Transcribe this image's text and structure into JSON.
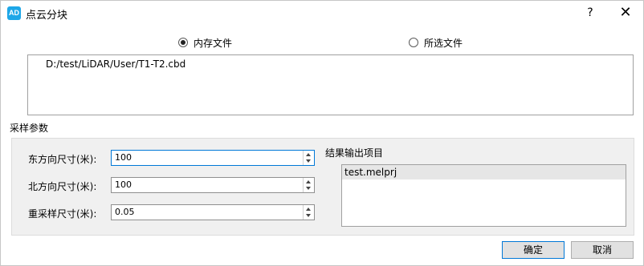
{
  "window": {
    "title": "点云分块",
    "icon_text": "AD",
    "help": "?",
    "close": "✕"
  },
  "source": {
    "options": [
      {
        "label": "内存文件",
        "checked": true
      },
      {
        "label": "所选文件",
        "checked": false
      }
    ],
    "files": [
      "D:/test/LiDAR/User/T1-T2.cbd"
    ]
  },
  "sampling": {
    "section_title": "采样参数",
    "east_label": "东方向尺寸(米):",
    "east_value": "100",
    "north_label": "北方向尺寸(米):",
    "north_value": "100",
    "resample_label": "重采样尺寸(米):",
    "resample_value": "0.05"
  },
  "output": {
    "label": "结果输出项目",
    "items": [
      "test.melprj"
    ]
  },
  "buttons": {
    "ok": "确定",
    "cancel": "取消"
  }
}
